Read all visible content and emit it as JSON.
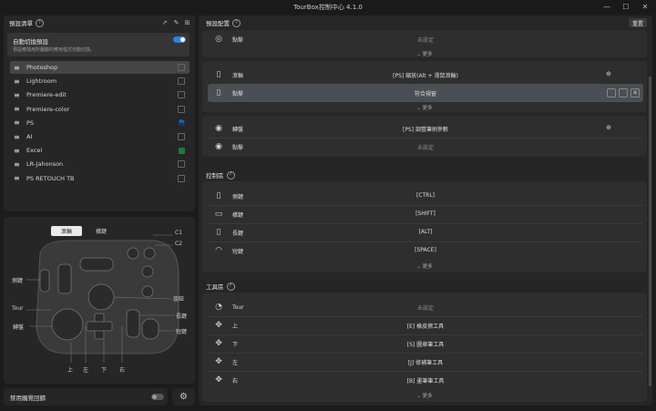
{
  "window": {
    "title": "TourBox控制中心 4.1.0",
    "minimize": "—",
    "maximize": "☐",
    "close": "✕"
  },
  "left": {
    "preset_list_title": "預設清單",
    "auto_switch": {
      "title": "自動切換預設",
      "desc": "預設應隨用所屬動的應用程式自動切換。",
      "on": true
    },
    "presets": [
      {
        "name": "Photoshop",
        "icon": "link-icon",
        "selected": true
      },
      {
        "name": "Lightroom",
        "icon": "link-icon"
      },
      {
        "name": "Premiere-edit",
        "icon": "link-icon"
      },
      {
        "name": "Premiere-color",
        "icon": "link-icon"
      },
      {
        "name": "PS",
        "icon": "ps-app-icon",
        "badge": "Ps"
      },
      {
        "name": "AI",
        "icon": "link-icon"
      },
      {
        "name": "Excel",
        "icon": "excel-app-icon"
      },
      {
        "name": "LR-Jahonson",
        "icon": "link-icon"
      },
      {
        "name": "PS RETOUCH TB",
        "icon": "link-icon"
      }
    ],
    "device_labels": {
      "tab_scroll": "滾輪",
      "tab_knob": "橫鍵",
      "c1": "C1",
      "c2": "C2",
      "side": "側鍵",
      "tour": "Tour",
      "dial": "轉盤",
      "knob": "旋鈕",
      "tall": "長鍵",
      "short": "短鍵",
      "up": "上",
      "left": "左",
      "down": "下",
      "right": "右"
    },
    "haptic_label": "禁用觸覺回饋",
    "haptic_on": false
  },
  "right": {
    "preset_config_title": "預設配置",
    "reset_label": "重置",
    "more_label": "更多",
    "group1": [
      {
        "icon": "knob-icon",
        "label": "點擊",
        "value": "未設定",
        "unset": true
      }
    ],
    "group2": [
      {
        "icon": "scroll-icon",
        "label": "滾輪",
        "value": "[PS] 縮放(Alt + 滑鼠滾輪)"
      },
      {
        "icon": "scroll-icon",
        "label": "點擊",
        "value": "符合視窗",
        "highlight": true
      }
    ],
    "group3": [
      {
        "icon": "dial-icon",
        "label": "轉盤",
        "value": "[PS] 調整筆刷參數"
      },
      {
        "icon": "dial-icon",
        "label": "點擊",
        "value": "未設定",
        "unset": true
      }
    ],
    "control_title": "控制區",
    "control": [
      {
        "icon": "side-key-icon",
        "label": "側鍵",
        "value": "[CTRL]"
      },
      {
        "icon": "top-key-icon",
        "label": "橫鍵",
        "value": "[SHIFT]"
      },
      {
        "icon": "tall-key-icon",
        "label": "長鍵",
        "value": "[ALT]"
      },
      {
        "icon": "short-key-icon",
        "label": "短鍵",
        "value": "[SPACE]"
      }
    ],
    "tools_title": "工具區",
    "tools": [
      {
        "icon": "tour-icon",
        "label": "Tour",
        "value": "未設定",
        "unset": true
      },
      {
        "icon": "dpad-up-icon",
        "label": "上",
        "value": "[E] 橡皮擦工具"
      },
      {
        "icon": "dpad-down-icon",
        "label": "下",
        "value": "[S] 圖章筆工具"
      },
      {
        "icon": "dpad-left-icon",
        "label": "左",
        "value": "[J] 修補筆工具"
      },
      {
        "icon": "dpad-right-icon",
        "label": "右",
        "value": "[B] 畫筆筆工具"
      }
    ]
  },
  "colors": {
    "accent": "#2f7fe0",
    "bg": "#1c1c1c",
    "panel": "#262626",
    "card": "#2e2e2e",
    "highlight": "#4a4f55"
  }
}
